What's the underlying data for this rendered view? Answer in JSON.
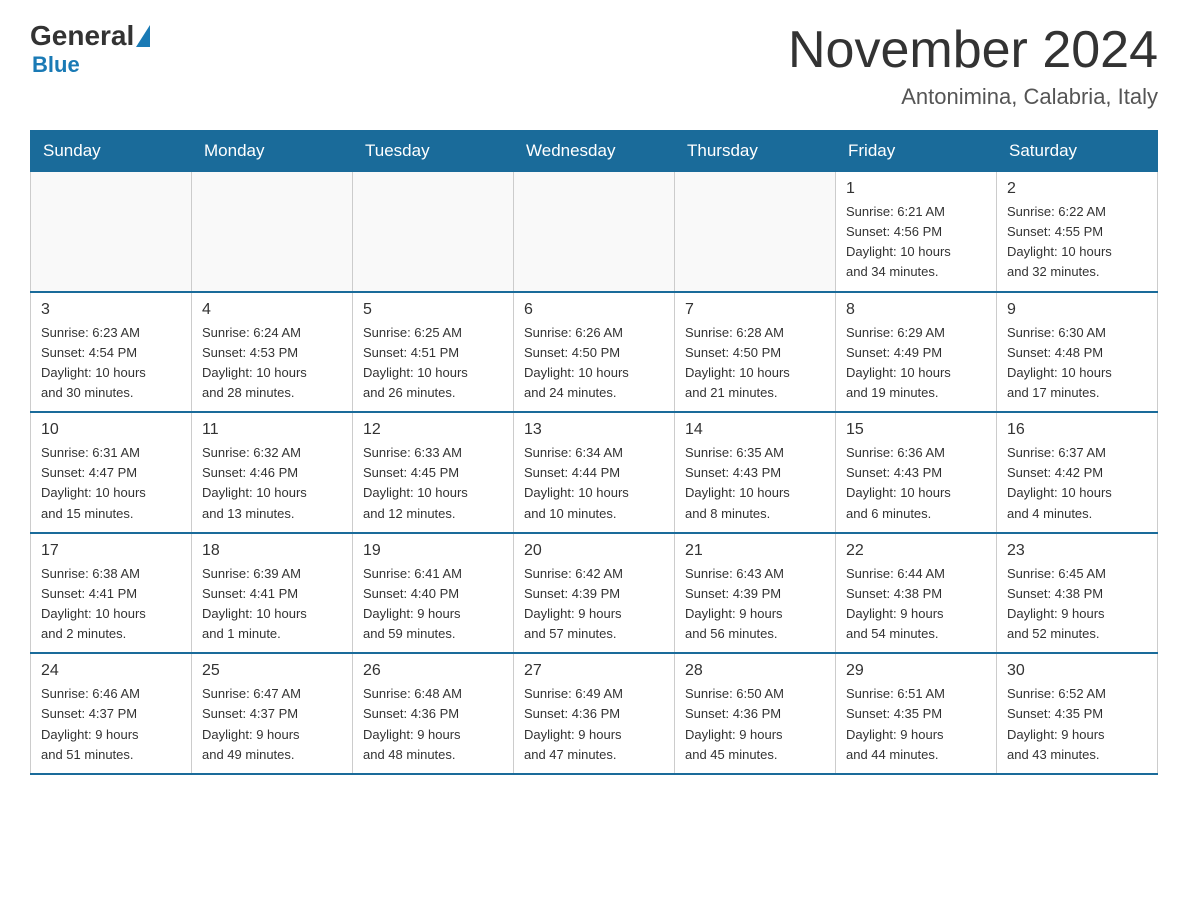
{
  "header": {
    "logo_general": "General",
    "logo_blue": "Blue",
    "month_title": "November 2024",
    "location": "Antonimina, Calabria, Italy"
  },
  "weekdays": [
    "Sunday",
    "Monday",
    "Tuesday",
    "Wednesday",
    "Thursday",
    "Friday",
    "Saturday"
  ],
  "weeks": [
    {
      "days": [
        {
          "num": "",
          "info": "",
          "empty": true
        },
        {
          "num": "",
          "info": "",
          "empty": true
        },
        {
          "num": "",
          "info": "",
          "empty": true
        },
        {
          "num": "",
          "info": "",
          "empty": true
        },
        {
          "num": "",
          "info": "",
          "empty": true
        },
        {
          "num": "1",
          "info": "Sunrise: 6:21 AM\nSunset: 4:56 PM\nDaylight: 10 hours\nand 34 minutes.",
          "empty": false
        },
        {
          "num": "2",
          "info": "Sunrise: 6:22 AM\nSunset: 4:55 PM\nDaylight: 10 hours\nand 32 minutes.",
          "empty": false
        }
      ]
    },
    {
      "days": [
        {
          "num": "3",
          "info": "Sunrise: 6:23 AM\nSunset: 4:54 PM\nDaylight: 10 hours\nand 30 minutes.",
          "empty": false
        },
        {
          "num": "4",
          "info": "Sunrise: 6:24 AM\nSunset: 4:53 PM\nDaylight: 10 hours\nand 28 minutes.",
          "empty": false
        },
        {
          "num": "5",
          "info": "Sunrise: 6:25 AM\nSunset: 4:51 PM\nDaylight: 10 hours\nand 26 minutes.",
          "empty": false
        },
        {
          "num": "6",
          "info": "Sunrise: 6:26 AM\nSunset: 4:50 PM\nDaylight: 10 hours\nand 24 minutes.",
          "empty": false
        },
        {
          "num": "7",
          "info": "Sunrise: 6:28 AM\nSunset: 4:50 PM\nDaylight: 10 hours\nand 21 minutes.",
          "empty": false
        },
        {
          "num": "8",
          "info": "Sunrise: 6:29 AM\nSunset: 4:49 PM\nDaylight: 10 hours\nand 19 minutes.",
          "empty": false
        },
        {
          "num": "9",
          "info": "Sunrise: 6:30 AM\nSunset: 4:48 PM\nDaylight: 10 hours\nand 17 minutes.",
          "empty": false
        }
      ]
    },
    {
      "days": [
        {
          "num": "10",
          "info": "Sunrise: 6:31 AM\nSunset: 4:47 PM\nDaylight: 10 hours\nand 15 minutes.",
          "empty": false
        },
        {
          "num": "11",
          "info": "Sunrise: 6:32 AM\nSunset: 4:46 PM\nDaylight: 10 hours\nand 13 minutes.",
          "empty": false
        },
        {
          "num": "12",
          "info": "Sunrise: 6:33 AM\nSunset: 4:45 PM\nDaylight: 10 hours\nand 12 minutes.",
          "empty": false
        },
        {
          "num": "13",
          "info": "Sunrise: 6:34 AM\nSunset: 4:44 PM\nDaylight: 10 hours\nand 10 minutes.",
          "empty": false
        },
        {
          "num": "14",
          "info": "Sunrise: 6:35 AM\nSunset: 4:43 PM\nDaylight: 10 hours\nand 8 minutes.",
          "empty": false
        },
        {
          "num": "15",
          "info": "Sunrise: 6:36 AM\nSunset: 4:43 PM\nDaylight: 10 hours\nand 6 minutes.",
          "empty": false
        },
        {
          "num": "16",
          "info": "Sunrise: 6:37 AM\nSunset: 4:42 PM\nDaylight: 10 hours\nand 4 minutes.",
          "empty": false
        }
      ]
    },
    {
      "days": [
        {
          "num": "17",
          "info": "Sunrise: 6:38 AM\nSunset: 4:41 PM\nDaylight: 10 hours\nand 2 minutes.",
          "empty": false
        },
        {
          "num": "18",
          "info": "Sunrise: 6:39 AM\nSunset: 4:41 PM\nDaylight: 10 hours\nand 1 minute.",
          "empty": false
        },
        {
          "num": "19",
          "info": "Sunrise: 6:41 AM\nSunset: 4:40 PM\nDaylight: 9 hours\nand 59 minutes.",
          "empty": false
        },
        {
          "num": "20",
          "info": "Sunrise: 6:42 AM\nSunset: 4:39 PM\nDaylight: 9 hours\nand 57 minutes.",
          "empty": false
        },
        {
          "num": "21",
          "info": "Sunrise: 6:43 AM\nSunset: 4:39 PM\nDaylight: 9 hours\nand 56 minutes.",
          "empty": false
        },
        {
          "num": "22",
          "info": "Sunrise: 6:44 AM\nSunset: 4:38 PM\nDaylight: 9 hours\nand 54 minutes.",
          "empty": false
        },
        {
          "num": "23",
          "info": "Sunrise: 6:45 AM\nSunset: 4:38 PM\nDaylight: 9 hours\nand 52 minutes.",
          "empty": false
        }
      ]
    },
    {
      "days": [
        {
          "num": "24",
          "info": "Sunrise: 6:46 AM\nSunset: 4:37 PM\nDaylight: 9 hours\nand 51 minutes.",
          "empty": false
        },
        {
          "num": "25",
          "info": "Sunrise: 6:47 AM\nSunset: 4:37 PM\nDaylight: 9 hours\nand 49 minutes.",
          "empty": false
        },
        {
          "num": "26",
          "info": "Sunrise: 6:48 AM\nSunset: 4:36 PM\nDaylight: 9 hours\nand 48 minutes.",
          "empty": false
        },
        {
          "num": "27",
          "info": "Sunrise: 6:49 AM\nSunset: 4:36 PM\nDaylight: 9 hours\nand 47 minutes.",
          "empty": false
        },
        {
          "num": "28",
          "info": "Sunrise: 6:50 AM\nSunset: 4:36 PM\nDaylight: 9 hours\nand 45 minutes.",
          "empty": false
        },
        {
          "num": "29",
          "info": "Sunrise: 6:51 AM\nSunset: 4:35 PM\nDaylight: 9 hours\nand 44 minutes.",
          "empty": false
        },
        {
          "num": "30",
          "info": "Sunrise: 6:52 AM\nSunset: 4:35 PM\nDaylight: 9 hours\nand 43 minutes.",
          "empty": false
        }
      ]
    }
  ]
}
